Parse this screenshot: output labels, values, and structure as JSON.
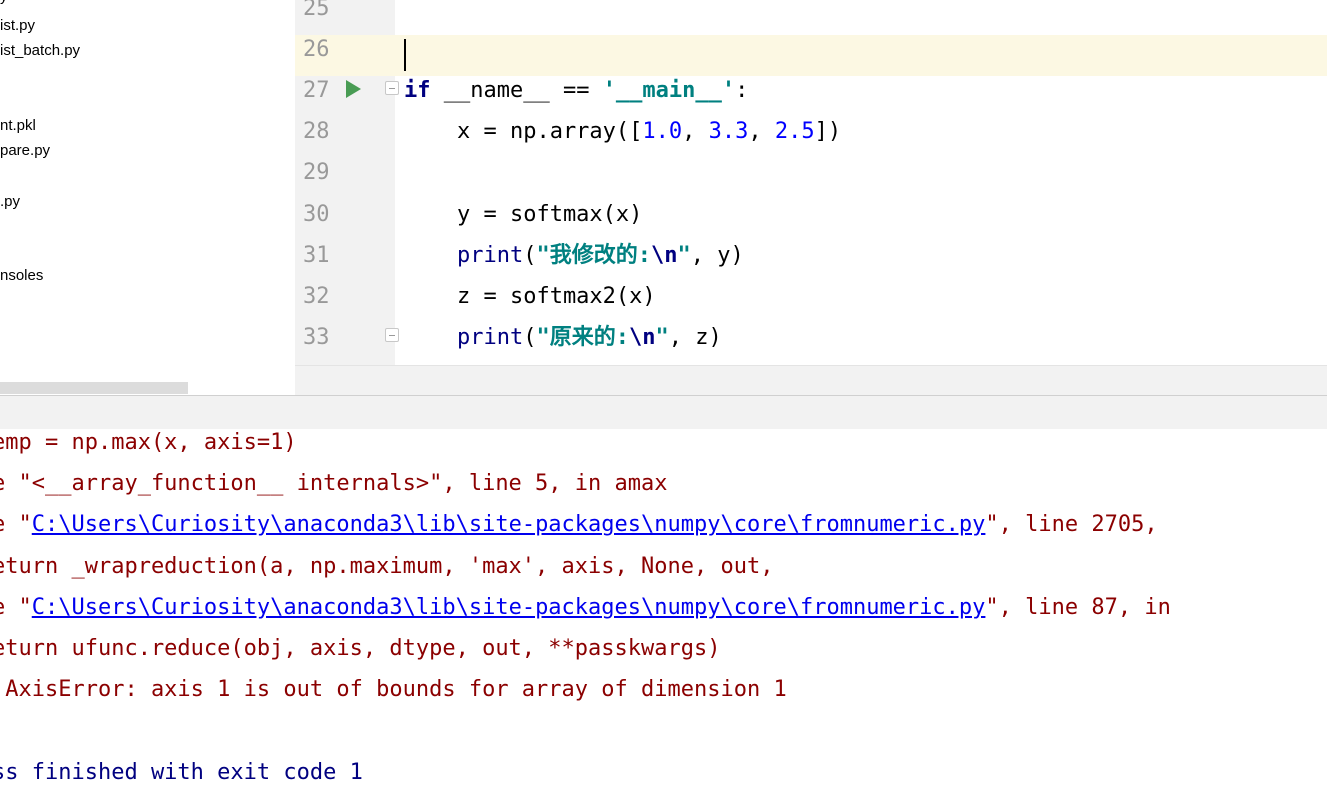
{
  "project_tree": {
    "items": [
      "y",
      "ist.py",
      "ist_batch.py",
      "nt.pkl",
      "pare.py",
      ".py",
      "nsoles"
    ]
  },
  "editor": {
    "lines": [
      {
        "num": "25"
      },
      {
        "num": "26"
      },
      {
        "num": "27",
        "kw": "if",
        "rest": " __name__ == ",
        "str": "'__main__'",
        "tail": ":"
      },
      {
        "num": "28",
        "a": "    x = np.array([",
        "n1": "1.0",
        "c1": ", ",
        "n2": "3.3",
        "c2": ", ",
        "n3": "2.5",
        "b": "])"
      },
      {
        "num": "29"
      },
      {
        "num": "30",
        "text": "    y = softmax(x)"
      },
      {
        "num": "31",
        "ind": "    ",
        "fn": "print",
        "p": "(",
        "s1": "\"我修改的:",
        "esc": "\\n",
        "s2": "\"",
        "tail": ", y)"
      },
      {
        "num": "32",
        "text": "    z = softmax2(x)"
      },
      {
        "num": "33",
        "ind": "    ",
        "fn": "print",
        "p": "(",
        "s1": "\"原来的:",
        "esc": "\\n",
        "s2": "\"",
        "tail": ", z)"
      }
    ]
  },
  "console": {
    "l1": "emp = np.max(x, axis=1)",
    "l2": "e \"<__array_function__ internals>\", line 5, in amax",
    "l3_pre": "e \"",
    "l3_link": "C:\\Users\\Curiosity\\anaconda3\\lib\\site-packages\\numpy\\core\\fromnumeric.py",
    "l3_post": "\", line 2705,",
    "l4": "eturn _wrapreduction(a, np.maximum, 'max', axis, None, out,",
    "l5_pre": "e \"",
    "l5_link": "C:\\Users\\Curiosity\\anaconda3\\lib\\site-packages\\numpy\\core\\fromnumeric.py",
    "l5_post": "\", line 87, in",
    "l6": "eturn ufunc.reduce(obj, axis, dtype, out, **passkwargs)",
    "l7": ".AxisError: axis 1 is out of bounds for array of dimension 1",
    "l8": "ss finished with exit code 1"
  },
  "colors": {
    "keyword": "#000080",
    "string": "#008080",
    "number": "#0000ff",
    "error_text": "#8b0000",
    "link": "#0000ee",
    "current_line": "#fcf8e3",
    "run_icon": "#499c54"
  }
}
